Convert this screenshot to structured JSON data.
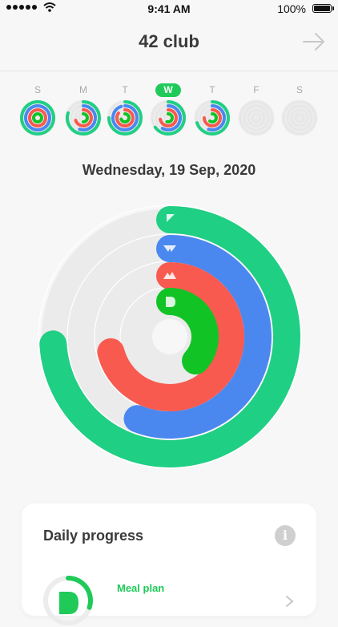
{
  "status_bar": {
    "time": "9:41 AM",
    "battery": "100%"
  },
  "header": {
    "title": "42 club",
    "next_icon": "arrow-right-icon"
  },
  "week": {
    "days": [
      {
        "label": "S",
        "active": false,
        "progress": [
          1,
          1,
          1,
          1
        ]
      },
      {
        "label": "M",
        "active": false,
        "progress": [
          0.8,
          0.55,
          0.7,
          0.5
        ]
      },
      {
        "label": "T",
        "active": false,
        "progress": [
          0.75,
          0.95,
          0.85,
          0.7
        ]
      },
      {
        "label": "W",
        "active": true,
        "progress": [
          0.65,
          0.58,
          0.72,
          0.55
        ]
      },
      {
        "label": "T",
        "active": false,
        "progress": [
          0.7,
          0.55,
          0.75,
          0.6
        ]
      },
      {
        "label": "F",
        "active": false,
        "progress": [
          0,
          0,
          0,
          0
        ]
      },
      {
        "label": "S",
        "active": false,
        "progress": [
          0,
          0,
          0,
          0
        ]
      }
    ]
  },
  "date": "Wednesday, 19 Sep, 2020",
  "rings": [
    {
      "name": "ring-green-outer",
      "color": "#1fcf84",
      "progress": 0.74,
      "icon": "flag-icon"
    },
    {
      "name": "ring-blue",
      "color": "#4a88f0",
      "progress": 0.56,
      "icon": "bird-icon"
    },
    {
      "name": "ring-red",
      "color": "#f85a4f",
      "progress": 0.71,
      "icon": "mountain-icon"
    },
    {
      "name": "ring-green-inner",
      "color": "#12c325",
      "progress": 0.37,
      "icon": "leaf-icon"
    }
  ],
  "colors": {
    "track": "#ebebeb",
    "accent": "#1fca59"
  },
  "card": {
    "title": "Daily progress",
    "info_icon": "info-icon",
    "item_label": "Meal plan",
    "item_progress": 0.3
  }
}
